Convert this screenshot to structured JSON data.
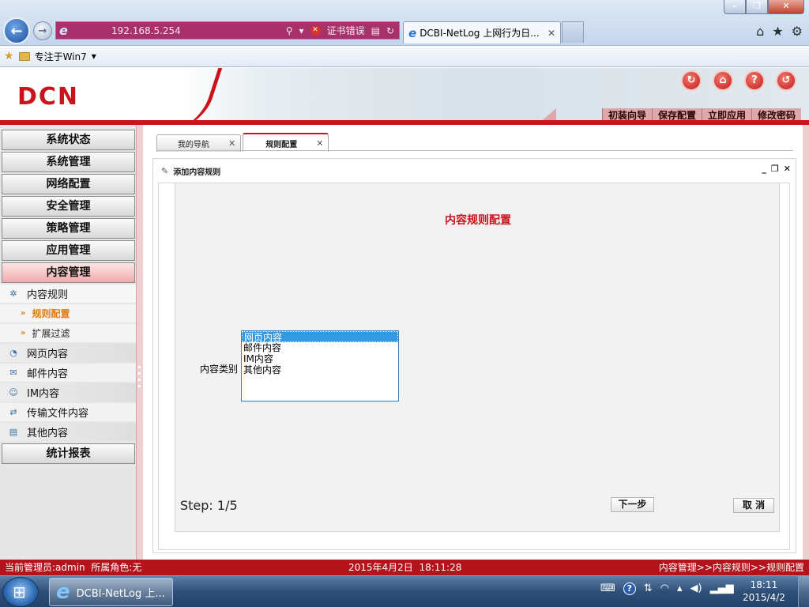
{
  "browser": {
    "url": "192.168.5.254",
    "cert_error": "证书错误",
    "tab_title": "DCBI-NetLog 上网行为日...",
    "favorites": {
      "label": "专注于Win7"
    }
  },
  "header": {
    "logo": "DCN",
    "toolbar": {
      "wizard": "初装向导",
      "save": "保存配置",
      "apply": "立即应用",
      "change_password": "修改密码"
    }
  },
  "sidebar": {
    "menus": {
      "system_status": "系统状态",
      "system_management": "系统管理",
      "network_config": "网络配置",
      "security_management": "安全管理",
      "policy_management": "策略管理",
      "application_management": "应用管理",
      "content_management": "内容管理",
      "statistics_reports": "统计报表"
    },
    "content_items": {
      "content_rules": "内容规则",
      "rule_config": "规则配置",
      "extended_filter": "扩展过滤",
      "web_content": "网页内容",
      "mail_content": "邮件内容",
      "im_content": "IM内容",
      "file_transfer_content": "传输文件内容",
      "other_content": "其他内容"
    }
  },
  "main": {
    "tabs": {
      "my_nav": "我的导航",
      "rule_config": "规则配置"
    },
    "panel_title": "添加内容规则",
    "form": {
      "title": "内容规则配置",
      "category_label": "内容类别",
      "category_options": [
        "网页内容",
        "邮件内容",
        "IM内容",
        "其他内容"
      ],
      "selected_option": "网页内容",
      "step": "Step: 1/5",
      "next": "下一步",
      "cancel": "取 消"
    }
  },
  "status_bar": {
    "admin": "当前管理员:admin  所属角色:无",
    "datetime": "2015年4月2日  18:11:28",
    "breadcrumb": "内容管理>>内容规则>>规则配置"
  },
  "taskbar": {
    "task_label": "DCBI-NetLog 上...",
    "time": "18:11",
    "date": "2015/4/2"
  },
  "colors": {
    "brand_red": "#c9141c",
    "highlight_orange": "#e07b12",
    "selection_blue": "#3399e0"
  }
}
